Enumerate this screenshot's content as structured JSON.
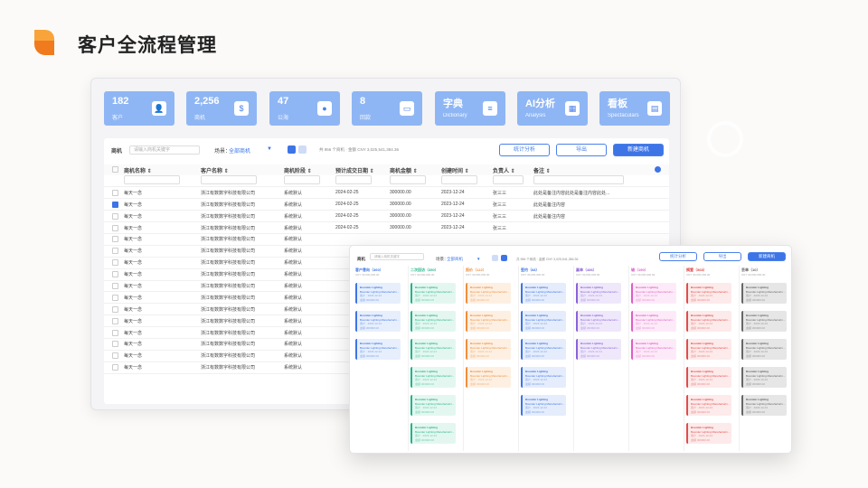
{
  "header": {
    "title": "客户全流程管理",
    "logo_colors": [
      "#f9a43a",
      "#f07a1e"
    ]
  },
  "stats": [
    {
      "value": "182",
      "label": "客户",
      "icon": "user-icon"
    },
    {
      "value": "2,256",
      "label": "商机",
      "icon": "dollar-icon"
    },
    {
      "value": "47",
      "label": "公海",
      "icon": "profile-icon"
    },
    {
      "value": "8",
      "label": "回款",
      "icon": "wallet-icon"
    },
    {
      "value": "字典",
      "label": "Dictionary",
      "icon": "document-icon"
    },
    {
      "value": "AI分析",
      "label": "Analysis",
      "icon": "layout-icon"
    },
    {
      "value": "看板",
      "label": "Spectaculars",
      "icon": "board-icon"
    }
  ],
  "toolbar": {
    "module_label": "商机",
    "search_placeholder": "请输入商机关键字",
    "scene_label": "场景：",
    "scene_value": "全部商机",
    "count_text": "共 956 个商机 · 金额 CNY 3,025,541,384.36",
    "stats_button": "统计分析",
    "export_button": "导出",
    "new_button": "新建商机"
  },
  "table": {
    "columns": [
      "商机名称 ⇕",
      "客户名称 ⇕",
      "商机阶段 ⇕",
      "预计成交日期 ⇕",
      "商机金额 ⇕",
      "创建时间 ⇕",
      "负责人 ⇕",
      "备注 ⇕"
    ],
    "rows": [
      {
        "checked": false,
        "cells": [
          "每天一念",
          "浙江有数数字科技有限公司",
          "系统默认",
          "2024-02-25",
          "300000.00",
          "2023-12-24",
          "张三三",
          "此处是备注内容此处是备注内容此处..."
        ]
      },
      {
        "checked": true,
        "cells": [
          "每天一念",
          "浙江有数数字科技有限公司",
          "系统默认",
          "2024-02-25",
          "300000.00",
          "2023-12-24",
          "张三三",
          "此处是备注内容"
        ]
      },
      {
        "checked": false,
        "cells": [
          "每天一念",
          "浙江有数数字科技有限公司",
          "系统默认",
          "2024-02-25",
          "300000.00",
          "2023-12-24",
          "张三三",
          "此处是备注内容"
        ]
      },
      {
        "checked": false,
        "cells": [
          "每天一念",
          "浙江有数数字科技有限公司",
          "系统默认",
          "2024-02-25",
          "300000.00",
          "2023-12-24",
          "张三三",
          ""
        ]
      },
      {
        "checked": false,
        "cells": [
          "每天一念",
          "浙江有数数字科技有限公司",
          "系统默认",
          "",
          "",
          "",
          "",
          ""
        ]
      },
      {
        "checked": false,
        "cells": [
          "每天一念",
          "浙江有数数字科技有限公司",
          "系统默认",
          "",
          "",
          "",
          "",
          ""
        ]
      },
      {
        "checked": false,
        "cells": [
          "每天一念",
          "浙江有数数字科技有限公司",
          "系统默认",
          "",
          "",
          "",
          "",
          ""
        ]
      },
      {
        "checked": false,
        "cells": [
          "每天一念",
          "浙江有数数字科技有限公司",
          "系统默认",
          "",
          "",
          "",
          "",
          ""
        ]
      },
      {
        "checked": false,
        "cells": [
          "每天一念",
          "浙江有数数字科技有限公司",
          "系统默认",
          "",
          "",
          "",
          "",
          ""
        ]
      },
      {
        "checked": false,
        "cells": [
          "每天一念",
          "浙江有数数字科技有限公司",
          "系统默认",
          "",
          "",
          "",
          "",
          ""
        ]
      },
      {
        "checked": false,
        "cells": [
          "每天一念",
          "浙江有数数字科技有限公司",
          "系统默认",
          "",
          "",
          "",
          "",
          ""
        ]
      },
      {
        "checked": false,
        "cells": [
          "每天一念",
          "浙江有数数字科技有限公司",
          "系统默认",
          "",
          "",
          "",
          "",
          ""
        ]
      },
      {
        "checked": false,
        "cells": [
          "每天一念",
          "浙江有数数字科技有限公司",
          "系统默认",
          "",
          "",
          "",
          "",
          ""
        ]
      },
      {
        "checked": false,
        "cells": [
          "每天一念",
          "浙江有数数字科技有限公司",
          "系统默认",
          "",
          "",
          "",
          "",
          ""
        ]
      },
      {
        "checked": false,
        "cells": [
          "每天一念",
          "浙江有数数字科技有限公司",
          "系统默认",
          "",
          "",
          "",
          "",
          ""
        ]
      },
      {
        "checked": false,
        "cells": [
          "每天一念",
          "浙江有数数字科技有限公司",
          "系统默认",
          "",
          "",
          "",
          "",
          ""
        ]
      }
    ]
  },
  "kanban": {
    "toolbar": {
      "module_label": "商机",
      "search_placeholder": "请输入商机关键字",
      "scene_label": "场景：",
      "scene_value": "全部商机",
      "count_text": "共 956 个商机 · 金额 CNY 3,025,541,384.36",
      "stats_button": "统计分析",
      "export_button": "导出",
      "new_button": "新建商机"
    },
    "card_text": {
      "name": "Bounder Lighting",
      "line": "Bounder Lighting Manufacturin...",
      "meta": "客户 · 2023-12-24",
      "meta2": "金额 300000.00"
    },
    "columns": [
      {
        "title": "客户意向（360）",
        "sub": "CNY 30,000,000.00",
        "color": "#3d74e6",
        "bg": "#e7effd",
        "cards": 3
      },
      {
        "title": "二次回访（350）",
        "sub": "CNY 30,000,000.00",
        "color": "#23b488",
        "bg": "#e3f7f0",
        "cards": 6
      },
      {
        "title": "报价（122）",
        "sub": "CNY 30,000,000.00",
        "color": "#ef8f3c",
        "bg": "#fdf0e3",
        "cards": 4
      },
      {
        "title": "签约（68）",
        "sub": "CNY 30,000,000.00",
        "color": "#3d74e6",
        "bg": "#e5edfc",
        "cards": 5
      },
      {
        "title": "赢单（486）",
        "sub": "CNY 30,000,000.00",
        "color": "#8a63d8",
        "bg": "#efe8fb",
        "cards": 3
      },
      {
        "title": "输（190）",
        "sub": "CNY 30,000,000.00",
        "color": "#e05cc6",
        "bg": "#fdeaf8",
        "cards": 3
      },
      {
        "title": "搁置（568）",
        "sub": "CNY 30,000,000.00",
        "color": "#e24b4b",
        "bg": "#fdeaea",
        "cards": 6
      },
      {
        "title": "丢单（10）",
        "sub": "CNY 30,000,000.00",
        "color": "#666666",
        "bg": "#e6e6e6",
        "cards": 5
      }
    ]
  }
}
